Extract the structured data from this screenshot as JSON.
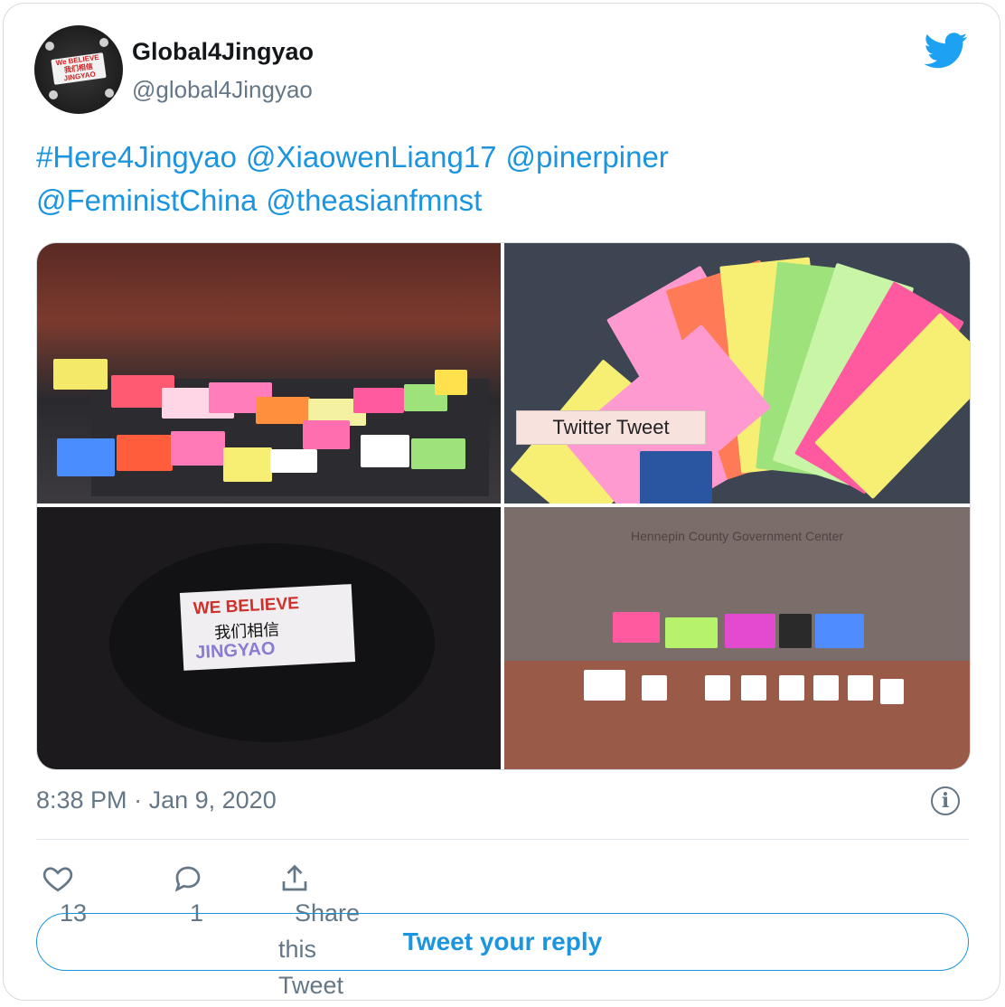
{
  "account": {
    "display_name": "Global4Jingyao",
    "handle": "@global4Jingyao",
    "avatar_sign_line1": "We BELIEVE",
    "avatar_sign_line2": "我们相信",
    "avatar_sign_line3": "JINGYAO"
  },
  "tweet": {
    "parts": [
      "#Here4Jingyao",
      "@XiaowenLiang17",
      "@pinerpiner",
      "@FeministChina",
      "@theasianfmnst"
    ]
  },
  "media": {
    "alt_tag": "Twitter Tweet",
    "icons": [
      "photo-group-signs",
      "photo-paper-fan",
      "photo-table-banner",
      "photo-government-center"
    ]
  },
  "meta": {
    "time": "8:38 PM",
    "separator": "·",
    "date": "Jan 9, 2020"
  },
  "actions": {
    "like_count": "13",
    "reply_count": "1",
    "share_label": "Share this Tweet"
  },
  "reply": {
    "button_label": "Tweet your reply"
  },
  "colors": {
    "link": "#1b95e0",
    "muted": "#657786",
    "text": "#14171a",
    "border": "#d6dbe0"
  }
}
